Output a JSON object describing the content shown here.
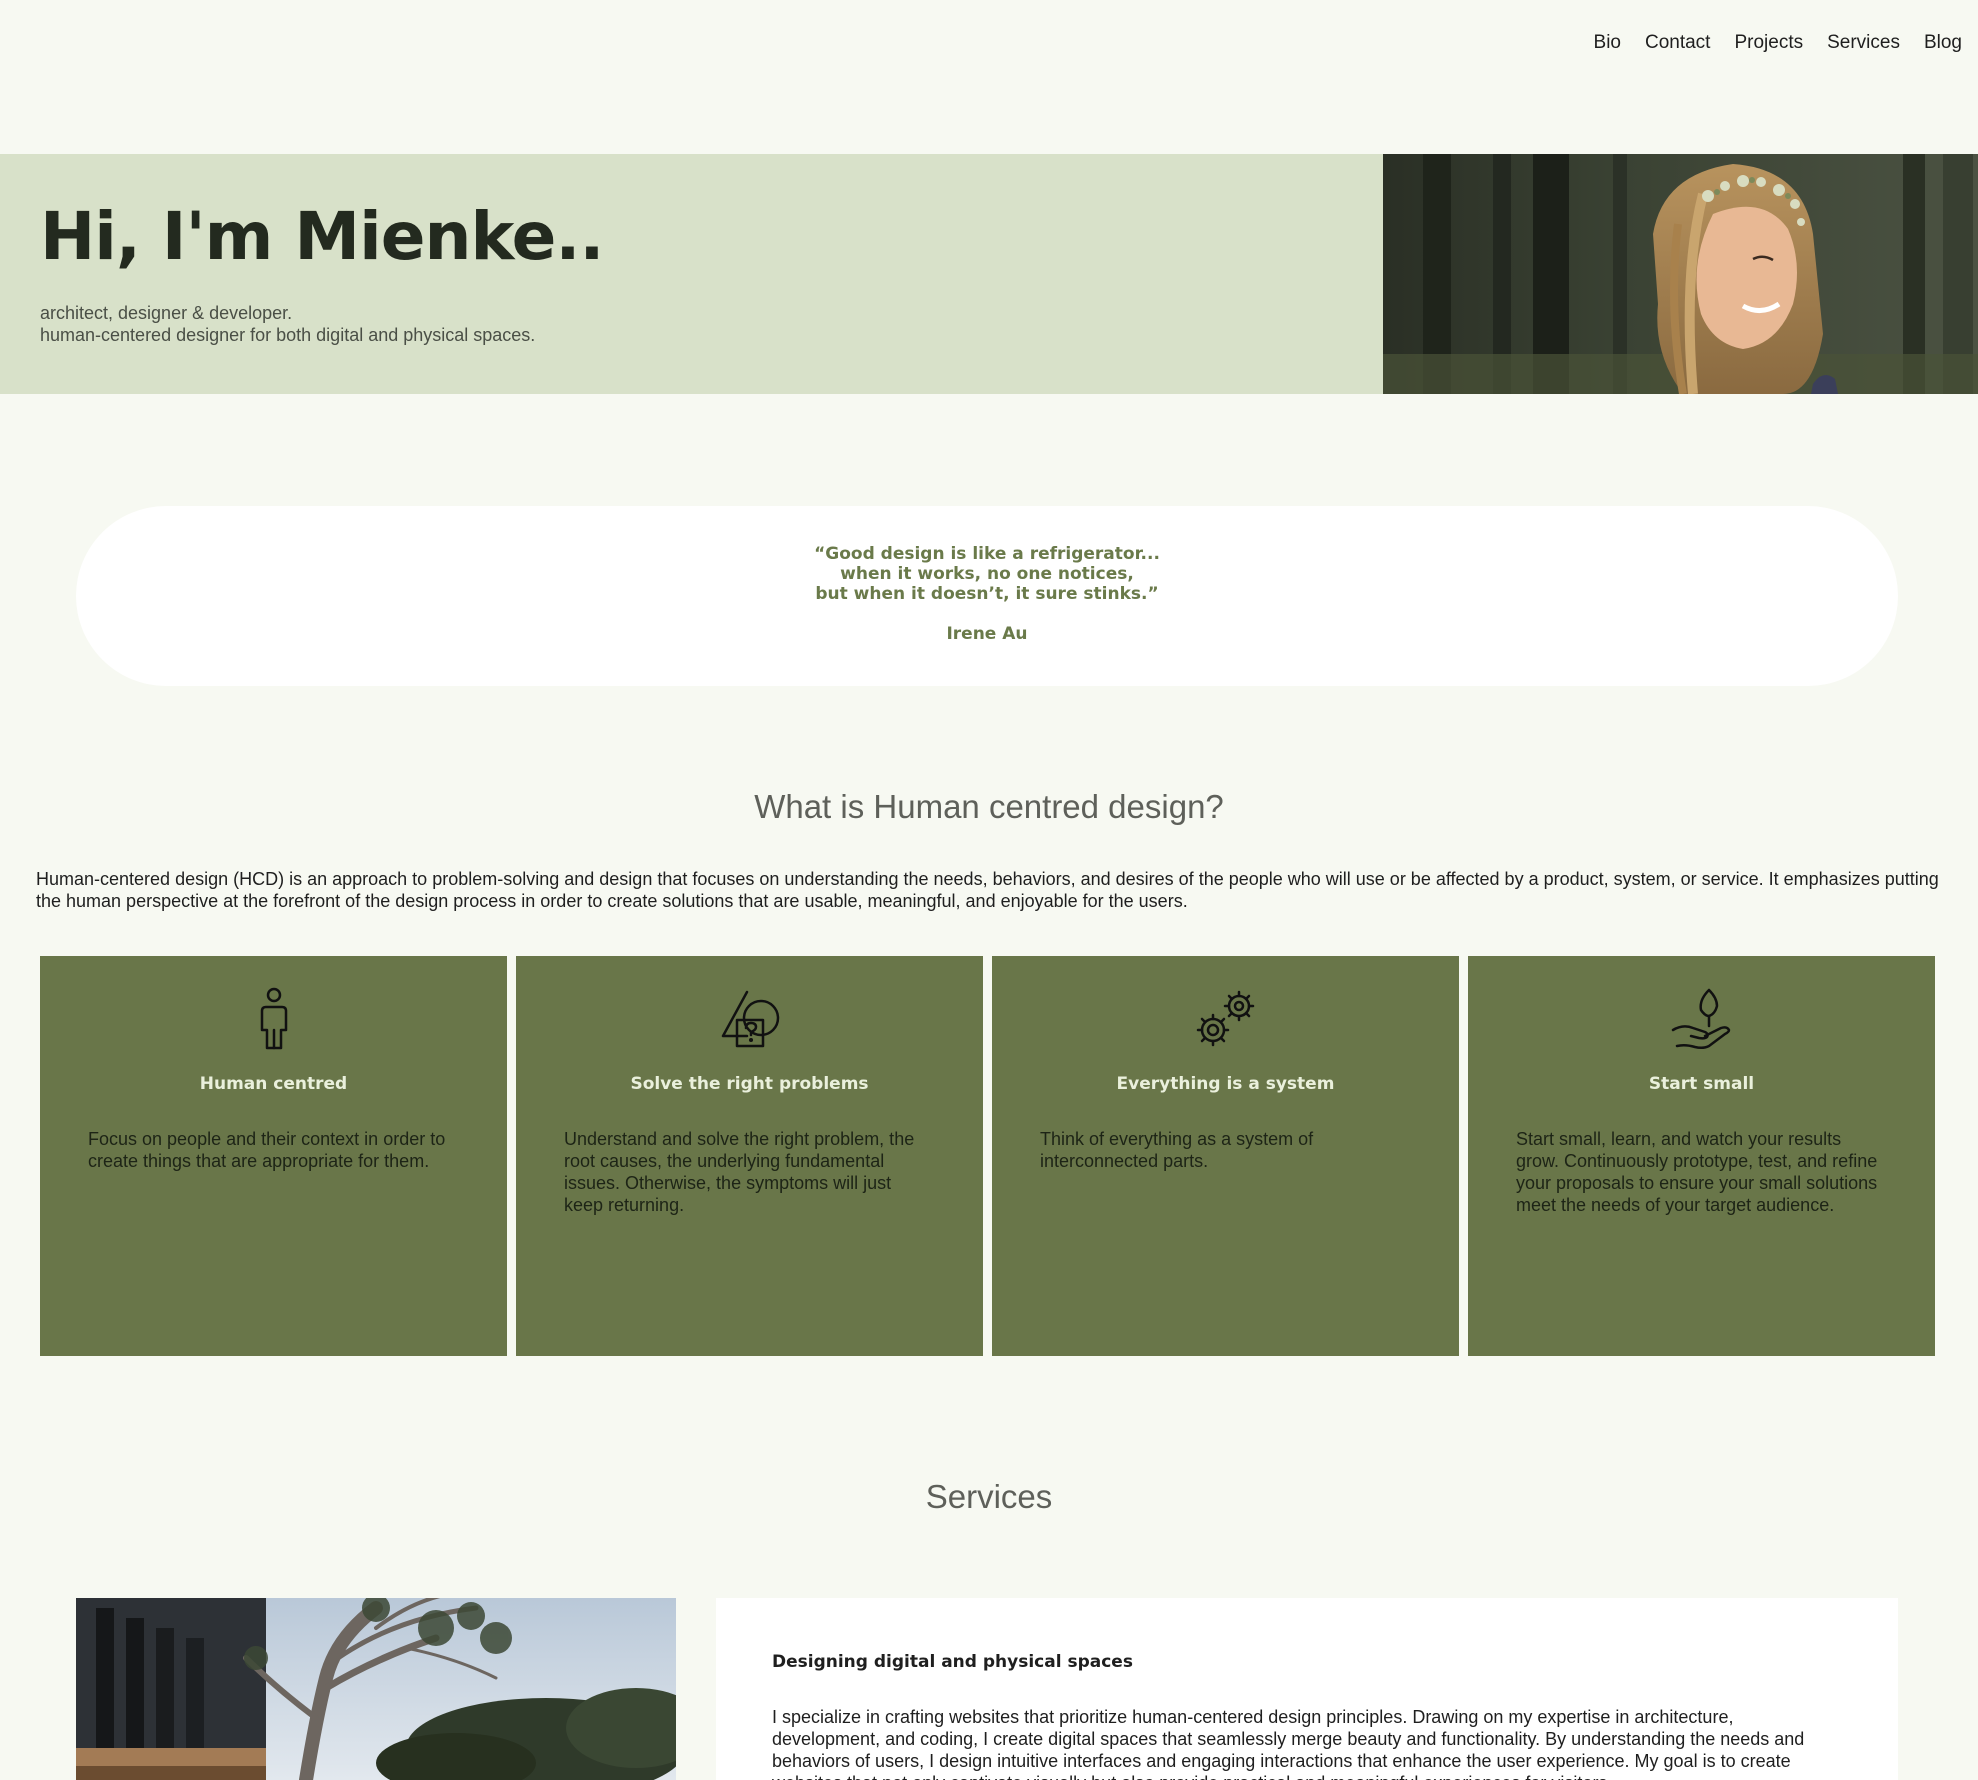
{
  "nav": {
    "items": [
      {
        "label": "Bio"
      },
      {
        "label": "Contact"
      },
      {
        "label": "Projects"
      },
      {
        "label": "Services"
      },
      {
        "label": "Blog"
      }
    ]
  },
  "hero": {
    "title": "Hi, I'm Mienke..",
    "subtitle_line1": "architect, designer & developer.",
    "subtitle_line2": "human-centered designer for both digital and physical spaces.",
    "background_color": "#d8e1c9"
  },
  "quote": {
    "text": "“Good design is like a refrigerator...\nwhen it works, no one notices,\nbut when it doesn’t, it sure stinks.”",
    "author": "Irene Au",
    "color": "#6a7a4a"
  },
  "hcd": {
    "title": "What is Human centred design?",
    "description": "Human-centered design (HCD) is an approach to problem-solving and design that focuses on understanding the needs, behaviors, and desires of the people who will use or be affected by a product, system, or service. It emphasizes putting the human perspective at the forefront of the design process in order to create solutions that are usable, meaningful, and enjoyable for the users.",
    "card_color": "#697649",
    "cards": [
      {
        "icon": "person-icon",
        "title": "Human centred",
        "text": "Focus on people and their context in order to create things that are appropriate for them."
      },
      {
        "icon": "question-shapes-icon",
        "title": "Solve the right problems",
        "text": "Understand and solve the right problem, the root causes, the underlying fundamental issues. Otherwise, the symptoms will just keep returning."
      },
      {
        "icon": "gears-icon",
        "title": "Everything is a system",
        "text": "Think of everything as a system of interconnected parts."
      },
      {
        "icon": "hand-sprout-icon",
        "title": "Start small",
        "text": "Start small, learn, and watch your results grow. Continuously prototype, test, and refine your proposals to ensure your small solutions meet the needs of your target audience."
      }
    ]
  },
  "services": {
    "title": "Services",
    "item": {
      "heading": "Designing digital and physical spaces",
      "text": "I specialize in crafting websites that prioritize human-centered design principles. Drawing on my expertise in architecture, development, and coding, I create digital spaces that seamlessly merge beauty and functionality. By understanding the needs and behaviors of users, I design intuitive interfaces and engaging interactions that enhance the user experience. My goal is to create websites that not only captivate visually but also provide practical and meaningful experiences for visitors."
    }
  },
  "colors": {
    "page_background": "#f7f9f2",
    "heading_gray": "#5e605a",
    "card_title": "#eaf0dc"
  }
}
